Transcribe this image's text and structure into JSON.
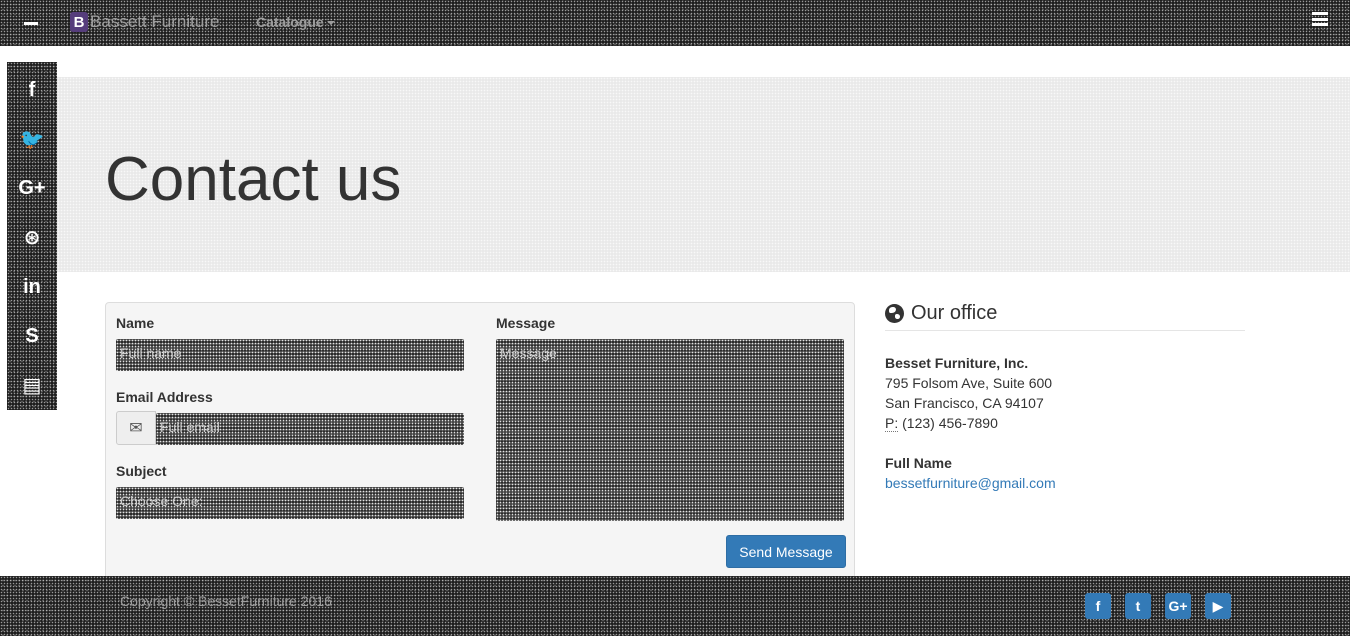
{
  "navbar": {
    "brand_letter": "B",
    "brand_name": "Bassett Furniture",
    "catalogue_label": "Catalogue"
  },
  "social_sidebar": [
    {
      "icon": "facebook-icon",
      "glyph": "f"
    },
    {
      "icon": "twitter-icon",
      "glyph": "🐦"
    },
    {
      "icon": "google-plus-icon",
      "glyph": "G+"
    },
    {
      "icon": "github-icon",
      "glyph": "⊛"
    },
    {
      "icon": "linkedin-icon",
      "glyph": "in"
    },
    {
      "icon": "skype-icon",
      "glyph": "S"
    },
    {
      "icon": "blog-icon",
      "glyph": "▤"
    }
  ],
  "jumbotron": {
    "title": "Contact us"
  },
  "form": {
    "name_label": "Name",
    "name_placeholder": "Full name",
    "email_label": "Email Address",
    "email_placeholder": "Full email",
    "subject_label": "Subject",
    "subject_placeholder": "Choose One:",
    "message_label": "Message",
    "message_placeholder": "Message",
    "send_label": "Send Message"
  },
  "office": {
    "title": "Our office",
    "company": "Besset Furniture, Inc.",
    "address_line1": "795 Folsom Ave, Suite 600",
    "address_line2": "San Francisco, CA 94107",
    "phone_abbr": "P:",
    "phone": "(123) 456-7890",
    "contact_name": "Full Name",
    "email": "bessetfurniture@gmail.com"
  },
  "footer": {
    "copyright": "Copyright © BessetFurniture 2016",
    "icons": [
      "facebook-icon",
      "twitter-icon",
      "google-plus-icon",
      "youtube-icon"
    ]
  },
  "colors": {
    "accent": "#337ab7",
    "navbar_bg": "#1e1e1e",
    "brand_logo": "#563d7c"
  }
}
